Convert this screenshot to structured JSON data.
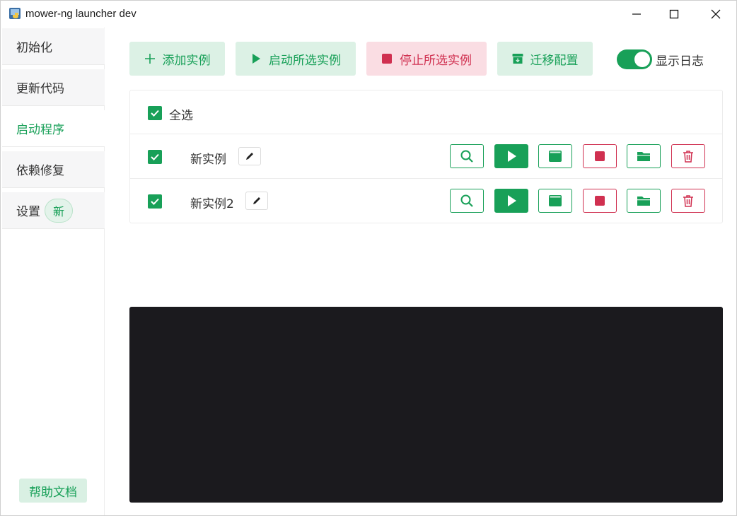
{
  "window": {
    "title": "mower-ng launcher dev"
  },
  "sidebar": {
    "items": [
      {
        "label": "初始化"
      },
      {
        "label": "更新代码"
      },
      {
        "label": "启动程序"
      },
      {
        "label": "依赖修复"
      },
      {
        "label": "设置",
        "badge": "新"
      }
    ],
    "help_label": "帮助文档"
  },
  "toolbar": {
    "add_label": "添加实例",
    "start_label": "启动所选实例",
    "stop_label": "停止所选实例",
    "migrate_label": "迁移配置",
    "show_log_label": "显示日志",
    "show_log_on": true
  },
  "instances": {
    "select_all_label": "全选",
    "rows": [
      {
        "name": "新实例",
        "checked": true
      },
      {
        "name": "新实例2",
        "checked": true
      }
    ]
  },
  "colors": {
    "accent": "#18a058",
    "danger": "#d03050",
    "log_bg": "#1b1a1e"
  }
}
